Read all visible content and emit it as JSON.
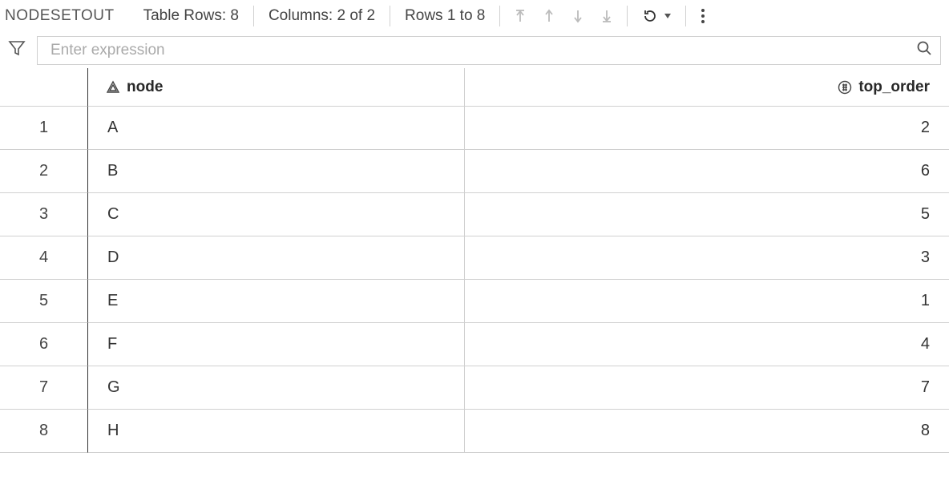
{
  "toolbar": {
    "table_name": "NODESETOUT",
    "rows_label": "Table Rows: 8",
    "cols_label": "Columns: 2 of 2",
    "range_label": "Rows 1 to 8"
  },
  "filter": {
    "placeholder": "Enter expression"
  },
  "columns": {
    "node": "node",
    "top_order": "top_order"
  },
  "rows": [
    {
      "idx": "1",
      "node": "A",
      "top_order": "2"
    },
    {
      "idx": "2",
      "node": "B",
      "top_order": "6"
    },
    {
      "idx": "3",
      "node": "C",
      "top_order": "5"
    },
    {
      "idx": "4",
      "node": "D",
      "top_order": "3"
    },
    {
      "idx": "5",
      "node": "E",
      "top_order": "1"
    },
    {
      "idx": "6",
      "node": "F",
      "top_order": "4"
    },
    {
      "idx": "7",
      "node": "G",
      "top_order": "7"
    },
    {
      "idx": "8",
      "node": "H",
      "top_order": "8"
    }
  ]
}
